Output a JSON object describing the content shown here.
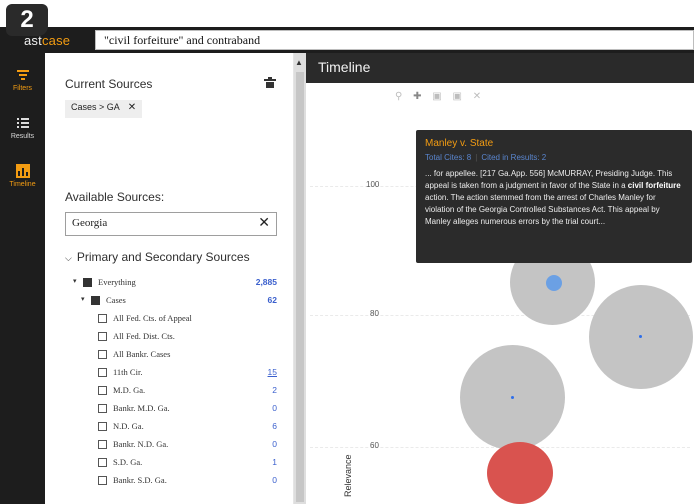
{
  "step_badge": "2",
  "brand": {
    "prefix": "ast",
    "accent": "case"
  },
  "search": {
    "query": "\"civil forfeiture\" and contraband"
  },
  "rail": [
    {
      "label": "Filters",
      "icon": "filter-icon",
      "active": true
    },
    {
      "label": "Results",
      "icon": "list-icon",
      "active": false
    },
    {
      "label": "Timeline",
      "icon": "timeline-icon",
      "active": true
    }
  ],
  "sources": {
    "current_title": "Current Sources",
    "current_chip": "Cases > GA",
    "available_title": "Available Sources:",
    "search_value": "Georgia",
    "tree_head": "Primary and Secondary Sources",
    "rows": [
      {
        "label": "Everything",
        "count": "2,885"
      },
      {
        "label": "Cases",
        "count": "62"
      },
      {
        "label": "All Fed. Cts. of Appeal",
        "count": ""
      },
      {
        "label": "All Fed. Dist. Cts.",
        "count": ""
      },
      {
        "label": "All Bankr. Cases",
        "count": ""
      },
      {
        "label": "11th Cir.",
        "count": "15"
      },
      {
        "label": "M.D. Ga.",
        "count": "2"
      },
      {
        "label": "Bankr. M.D. Ga.",
        "count": "0"
      },
      {
        "label": "N.D. Ga.",
        "count": "6"
      },
      {
        "label": "Bankr. N.D. Ga.",
        "count": "0"
      },
      {
        "label": "S.D. Ga.",
        "count": "1"
      },
      {
        "label": "Bankr. S.D. Ga.",
        "count": "0"
      }
    ]
  },
  "timeline": {
    "title": "Timeline",
    "y_axis_label": "Relevance",
    "y_ticks": [
      "100",
      "80",
      "60"
    ],
    "tooltip": {
      "title": "Manley v. State",
      "total_cites": "Total Cites: 8",
      "cited_in_results": "Cited in Results: 2",
      "body_pre": "... for appellee. [217 Ga.App. 556] McMURRAY, Presiding Judge. This appeal is taken from a judgment in favor of the State in a ",
      "body_bold": "civil forfeiture",
      "body_post": " action. The action stemmed from the arrest of Charles Manley for violation of the Georgia Controlled Substances Act. This appeal by Manley alleges numerous errors by the trial court..."
    }
  }
}
